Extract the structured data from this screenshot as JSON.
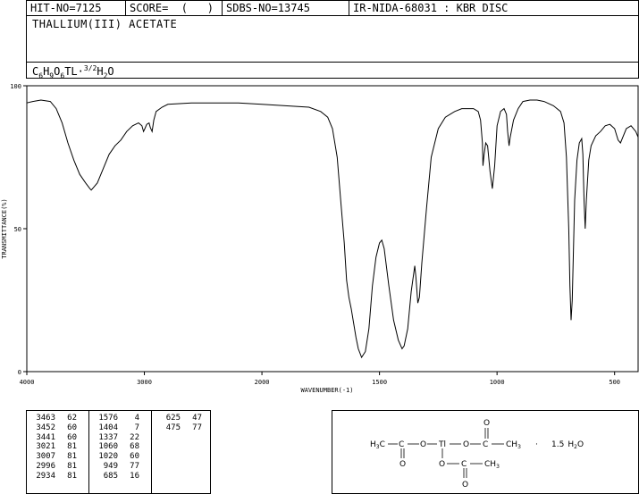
{
  "header": {
    "hit_no": "HIT-NO=7125",
    "score": "SCORE=  (   )",
    "sdbs_no": "SDBS-NO=13745",
    "ir_source": "IR-NIDA-68031 : KBR DISC"
  },
  "compound_name": "THALLIUM(III) ACETATE",
  "formula": {
    "parts": [
      "C",
      "6",
      "H",
      "9",
      "O",
      "6",
      "TL",
      "",
      "·",
      "",
      "3/2",
      "H",
      "2",
      "O"
    ]
  },
  "chart_data": {
    "type": "line",
    "xlabel": "WAVENUMBER(-1)",
    "ylabel": "TRANSMITTANCE(%)",
    "xlim": [
      4000,
      400
    ],
    "ylim": [
      0,
      100
    ],
    "x_ticks": [
      "4000",
      "3000",
      "2000",
      "1500",
      "1000",
      "500"
    ],
    "x_tick_values": [
      4000,
      3000,
      2000,
      1500,
      1000,
      500
    ],
    "y_ticks": [
      "0",
      "50",
      "100"
    ],
    "y_tick_values": [
      0,
      50,
      100
    ],
    "series": [
      {
        "points": [
          [
            4000,
            94
          ],
          [
            3950,
            94.5
          ],
          [
            3880,
            95
          ],
          [
            3800,
            94.5
          ],
          [
            3750,
            92
          ],
          [
            3700,
            87
          ],
          [
            3650,
            80
          ],
          [
            3600,
            74
          ],
          [
            3550,
            69
          ],
          [
            3500,
            66
          ],
          [
            3463,
            64
          ],
          [
            3452,
            63.5
          ],
          [
            3441,
            64
          ],
          [
            3400,
            66
          ],
          [
            3350,
            71
          ],
          [
            3300,
            76
          ],
          [
            3250,
            79
          ],
          [
            3200,
            81
          ],
          [
            3150,
            84
          ],
          [
            3100,
            86
          ],
          [
            3050,
            87
          ],
          [
            3021,
            86
          ],
          [
            3007,
            84
          ],
          [
            2996,
            85
          ],
          [
            2980,
            86.5
          ],
          [
            2960,
            87
          ],
          [
            2950,
            85.5
          ],
          [
            2934,
            84
          ],
          [
            2920,
            88
          ],
          [
            2900,
            91
          ],
          [
            2850,
            92.5
          ],
          [
            2800,
            93.5
          ],
          [
            2600,
            94
          ],
          [
            2400,
            94
          ],
          [
            2200,
            94
          ],
          [
            2000,
            93.5
          ],
          [
            1900,
            93
          ],
          [
            1800,
            92.5
          ],
          [
            1750,
            91
          ],
          [
            1720,
            89
          ],
          [
            1700,
            85
          ],
          [
            1680,
            75
          ],
          [
            1665,
            60
          ],
          [
            1650,
            45
          ],
          [
            1640,
            32
          ],
          [
            1630,
            26
          ],
          [
            1620,
            22
          ],
          [
            1600,
            12
          ],
          [
            1590,
            8
          ],
          [
            1576,
            5
          ],
          [
            1560,
            7
          ],
          [
            1545,
            15
          ],
          [
            1530,
            30
          ],
          [
            1515,
            40
          ],
          [
            1500,
            45
          ],
          [
            1490,
            46
          ],
          [
            1480,
            43
          ],
          [
            1460,
            30
          ],
          [
            1440,
            18
          ],
          [
            1420,
            11
          ],
          [
            1404,
            8
          ],
          [
            1395,
            9
          ],
          [
            1380,
            15
          ],
          [
            1365,
            28
          ],
          [
            1350,
            37
          ],
          [
            1345,
            33
          ],
          [
            1337,
            24
          ],
          [
            1330,
            26
          ],
          [
            1320,
            38
          ],
          [
            1300,
            57
          ],
          [
            1280,
            75
          ],
          [
            1250,
            85
          ],
          [
            1220,
            89
          ],
          [
            1180,
            91
          ],
          [
            1150,
            92
          ],
          [
            1100,
            92
          ],
          [
            1080,
            91
          ],
          [
            1070,
            88
          ],
          [
            1062,
            80
          ],
          [
            1060,
            72
          ],
          [
            1055,
            76
          ],
          [
            1048,
            80
          ],
          [
            1040,
            79
          ],
          [
            1030,
            70
          ],
          [
            1020,
            64
          ],
          [
            1010,
            72
          ],
          [
            1000,
            86
          ],
          [
            985,
            91
          ],
          [
            970,
            92
          ],
          [
            960,
            90
          ],
          [
            955,
            84
          ],
          [
            949,
            79
          ],
          [
            944,
            82
          ],
          [
            930,
            88
          ],
          [
            910,
            92
          ],
          [
            890,
            94.5
          ],
          [
            860,
            95
          ],
          [
            830,
            95
          ],
          [
            800,
            94.5
          ],
          [
            760,
            93
          ],
          [
            730,
            91
          ],
          [
            715,
            87
          ],
          [
            705,
            75
          ],
          [
            695,
            50
          ],
          [
            690,
            30
          ],
          [
            685,
            18
          ],
          [
            680,
            25
          ],
          [
            670,
            60
          ],
          [
            660,
            74
          ],
          [
            650,
            80
          ],
          [
            640,
            81.5
          ],
          [
            635,
            76
          ],
          [
            630,
            60
          ],
          [
            625,
            50
          ],
          [
            620,
            60
          ],
          [
            610,
            74
          ],
          [
            600,
            79
          ],
          [
            580,
            82.5
          ],
          [
            560,
            84
          ],
          [
            540,
            86
          ],
          [
            520,
            86.5
          ],
          [
            500,
            85
          ],
          [
            485,
            81
          ],
          [
            475,
            80
          ],
          [
            465,
            82
          ],
          [
            450,
            85
          ],
          [
            430,
            86
          ],
          [
            410,
            84
          ],
          [
            400,
            82
          ]
        ]
      }
    ]
  },
  "peak_table": {
    "columns": [
      [
        [
          "3463",
          "62"
        ],
        [
          "3452",
          "60"
        ],
        [
          "3441",
          "60"
        ],
        [
          "3021",
          "81"
        ],
        [
          "3007",
          "81"
        ],
        [
          "2996",
          "81"
        ],
        [
          "2934",
          "81"
        ]
      ],
      [
        [
          "1576",
          "4"
        ],
        [
          "1404",
          "7"
        ],
        [
          "1337",
          "22"
        ],
        [
          "1060",
          "68"
        ],
        [
          "1020",
          "60"
        ],
        [
          "949",
          "77"
        ],
        [
          "685",
          "16"
        ]
      ],
      [
        [
          "625",
          "47"
        ],
        [
          "475",
          "77"
        ]
      ]
    ]
  },
  "structure": {
    "h3c": "H",
    "h3c_sub": "3",
    "h3c_c": "C",
    "c": "C",
    "o": "O",
    "tl": "Tl",
    "ch3": "CH",
    "ch3_sub": "3",
    "water_dot": "·",
    "water_coef": "1.5",
    "water_h": "H",
    "water_sub": "2",
    "water_o": "O"
  }
}
